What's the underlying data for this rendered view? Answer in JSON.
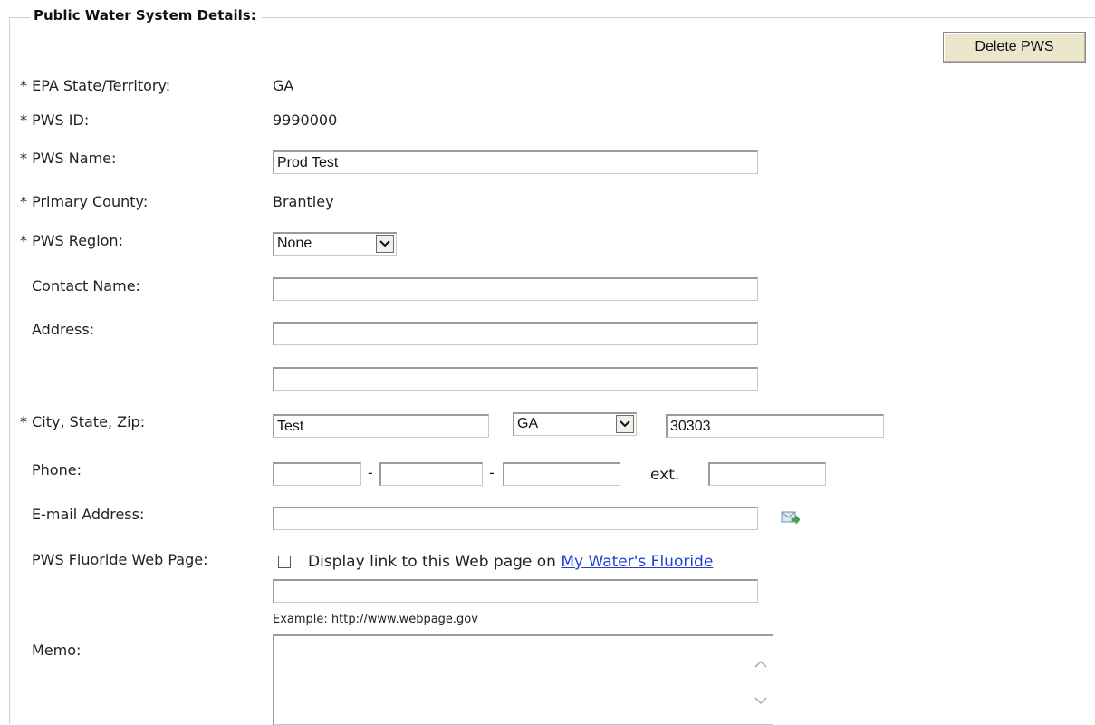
{
  "section": {
    "legend": "Public Water System Details:",
    "delete_button": "Delete PWS"
  },
  "fields": {
    "epa_state": {
      "label": "* EPA State/Territory:",
      "value": "GA"
    },
    "pws_id": {
      "label": "* PWS ID:",
      "value": "9990000"
    },
    "pws_name": {
      "label": "* PWS Name:",
      "value": "Prod Test"
    },
    "primary_county": {
      "label": "* Primary County:",
      "value": "Brantley"
    },
    "pws_region": {
      "label": "* PWS Region:",
      "selected": "None"
    },
    "contact_name": {
      "label": "Contact Name:",
      "value": ""
    },
    "address": {
      "label": "Address:",
      "line1": "",
      "line2": ""
    },
    "city_state_zip": {
      "label": "* City, State, Zip:",
      "city": "Test",
      "state": "GA",
      "zip": "30303"
    },
    "phone": {
      "label": "Phone:",
      "dash": "-",
      "ext_label": "ext.",
      "area": "",
      "prefix": "",
      "line": "",
      "ext": ""
    },
    "email": {
      "label": "E-mail Address:",
      "value": "",
      "icon": "send-email-icon"
    },
    "fluoride_web": {
      "label": "PWS Fluoride Web Page:",
      "checkbox_text": "Display link to this Web page on",
      "link_text": "My Water's Fluoride",
      "checked": false,
      "url_value": "",
      "example": "Example: http://www.webpage.gov"
    },
    "memo": {
      "label": "Memo:",
      "value": ""
    }
  },
  "colors": {
    "link": "#1f3fd6",
    "button_bg": "#ece6cc"
  }
}
